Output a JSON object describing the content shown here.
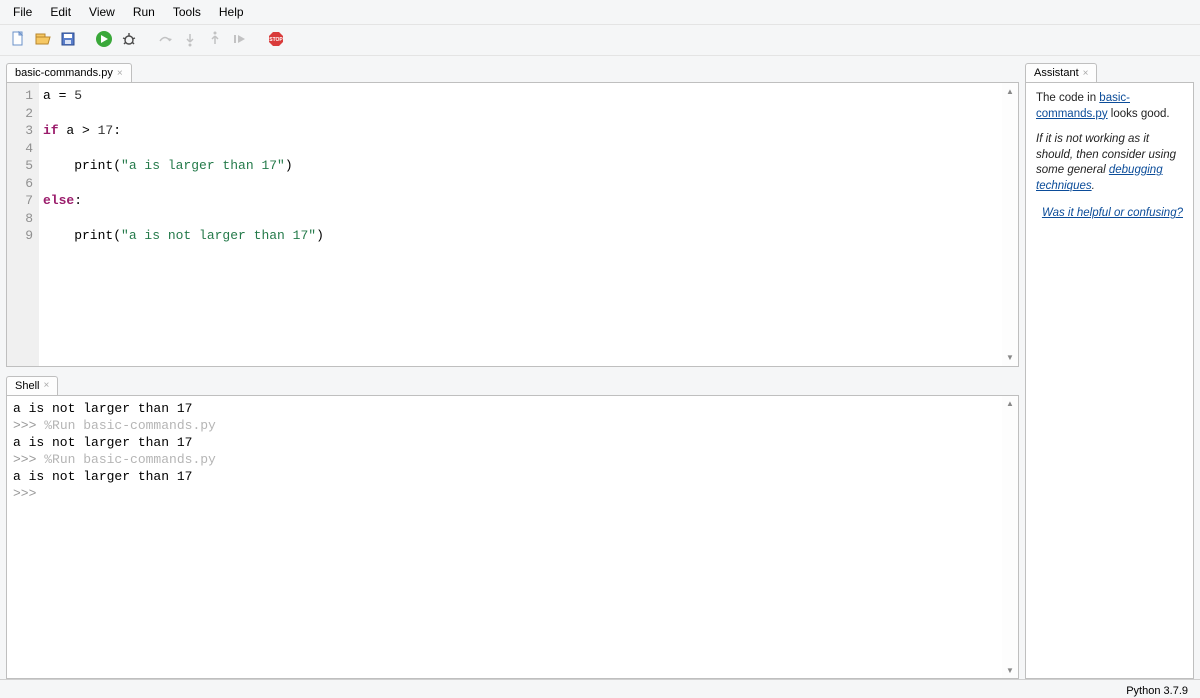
{
  "menu": {
    "file": "File",
    "edit": "Edit",
    "view": "View",
    "run": "Run",
    "tools": "Tools",
    "help": "Help"
  },
  "tabs": {
    "editor": "basic-commands.py",
    "shell": "Shell",
    "assistant": "Assistant"
  },
  "editor": {
    "gutter": [
      "1",
      "2",
      "3",
      "4",
      "5",
      "6",
      "7",
      "8",
      "9"
    ],
    "lines": [
      {
        "indent": "",
        "t": [
          [
            "",
            "a = "
          ],
          [
            "num",
            "5"
          ]
        ]
      },
      {
        "indent": "",
        "t": []
      },
      {
        "indent": "",
        "t": [
          [
            "kw",
            "if"
          ],
          [
            "",
            " a > "
          ],
          [
            "num",
            "17"
          ],
          [
            "",
            ":"
          ]
        ]
      },
      {
        "indent": "",
        "t": []
      },
      {
        "indent": "    ",
        "t": [
          [
            "",
            "print("
          ],
          [
            "str",
            "\"a is larger than 17\""
          ],
          [
            "",
            ")"
          ]
        ]
      },
      {
        "indent": "",
        "t": []
      },
      {
        "indent": "",
        "t": [
          [
            "kw",
            "else"
          ],
          [
            "",
            ":"
          ]
        ]
      },
      {
        "indent": "",
        "t": []
      },
      {
        "indent": "    ",
        "t": [
          [
            "",
            "print("
          ],
          [
            "str",
            "\"a is not larger than 17\""
          ],
          [
            "",
            ")"
          ]
        ]
      }
    ]
  },
  "shell": {
    "lines": [
      {
        "p": " ",
        "text": "a is not larger than 17"
      },
      {
        "p": ">>>",
        "text": "%Run basic-commands.py",
        "magic": true
      },
      {
        "p": " ",
        "text": "a is not larger than 17"
      },
      {
        "p": ">>>",
        "text": "%Run basic-commands.py",
        "magic": true
      },
      {
        "p": " ",
        "text": "a is not larger than 17"
      },
      {
        "p": ">>>",
        "text": ""
      }
    ]
  },
  "assistant": {
    "intro_pre": "The code in ",
    "intro_link": "basic-commands.py",
    "intro_post": " looks good.",
    "tip_pre": "If it is not working as it should, then consider using some general ",
    "tip_link": "debugging techniques",
    "tip_post": ".",
    "feedback": "Was it helpful or confusing?"
  },
  "status": {
    "python": "Python 3.7.9"
  }
}
